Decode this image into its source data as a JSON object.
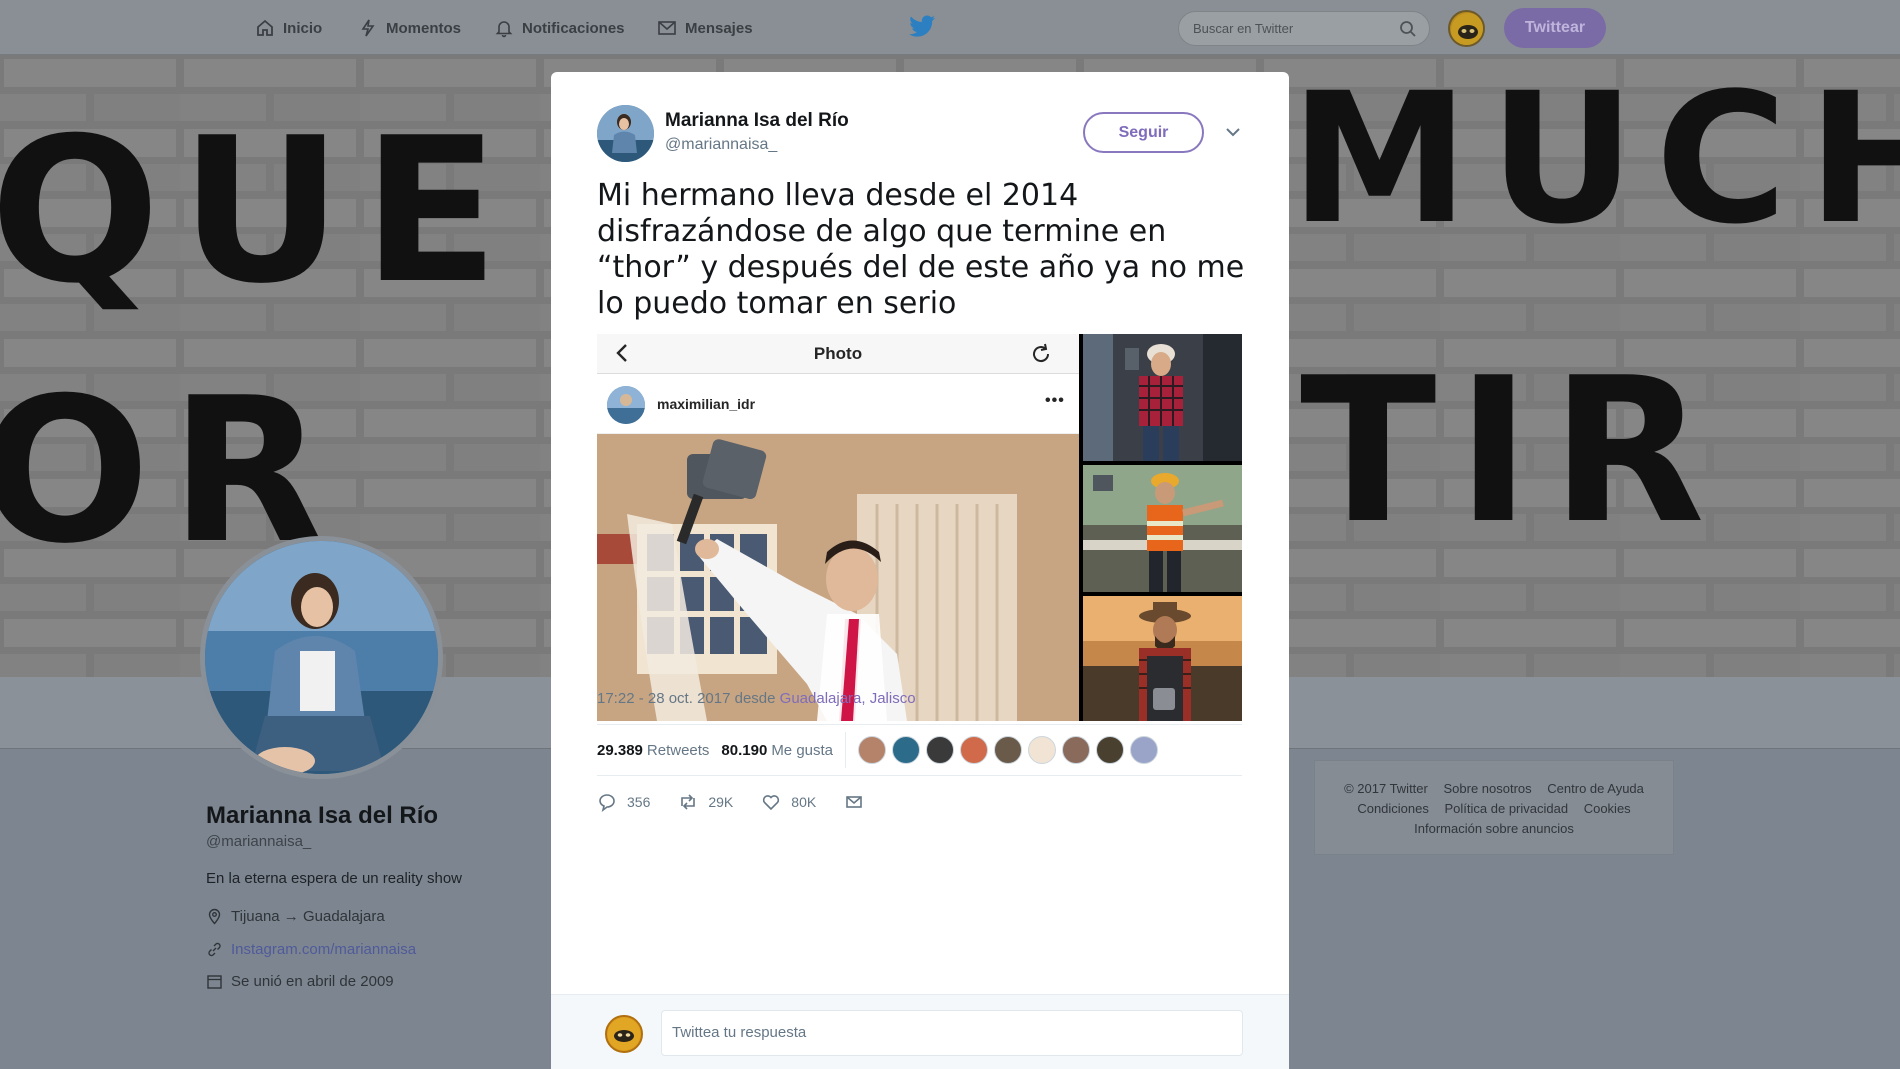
{
  "nav": {
    "items": [
      {
        "label": "Inicio",
        "icon": "home-icon"
      },
      {
        "label": "Momentos",
        "icon": "lightning-icon"
      },
      {
        "label": "Notificaciones",
        "icon": "bell-icon"
      },
      {
        "label": "Mensajes",
        "icon": "envelope-icon"
      }
    ],
    "search_placeholder": "Buscar en Twitter",
    "tweet_button": "Twittear"
  },
  "banner": {
    "line1": "QUE",
    "line2": "MUCH",
    "line3": "OR",
    "line4": "TIR"
  },
  "profile": {
    "name": "Marianna Isa del Río",
    "handle": "@mariannaisa_",
    "bio": "En la eterna espera de un reality show",
    "location": "Tijuana → Guadalajara",
    "link": "Instagram.com/mariannaisa",
    "joined": "Se unió en abril de 2009"
  },
  "footer": {
    "row1": [
      "© 2017 Twitter",
      "Sobre nosotros",
      "Centro de Ayuda"
    ],
    "row2": [
      "Condiciones",
      "Política de privacidad",
      "Cookies"
    ],
    "row3": [
      "Información sobre anuncios"
    ]
  },
  "tweet": {
    "author_name": "Marianna Isa del Río",
    "author_handle": "@mariannaisa_",
    "follow_label": "Seguir",
    "text": "Mi hermano lleva desde el 2014 disfrazándose de algo que termine en “thor” y después del de este año ya no me lo puedo tomar en serio",
    "media": {
      "screen_title": "Photo",
      "username": "maximilian_idr",
      "more": "•••"
    },
    "time": "17:22 - 28 oct. 2017 desde",
    "location": "Guadalajara, Jalisco",
    "retweets_count": "29.389",
    "retweets_label": "Retweets",
    "likes_count": "80.190",
    "likes_label": "Me gusta",
    "actions": {
      "replies": "356",
      "retweets": "29K",
      "likes": "80K"
    },
    "reply_placeholder": "Twittea tu respuesta"
  },
  "colors": {
    "accent": "#7f6cba",
    "modal_bg": "#ffffff",
    "overlay": "#7d8690"
  }
}
